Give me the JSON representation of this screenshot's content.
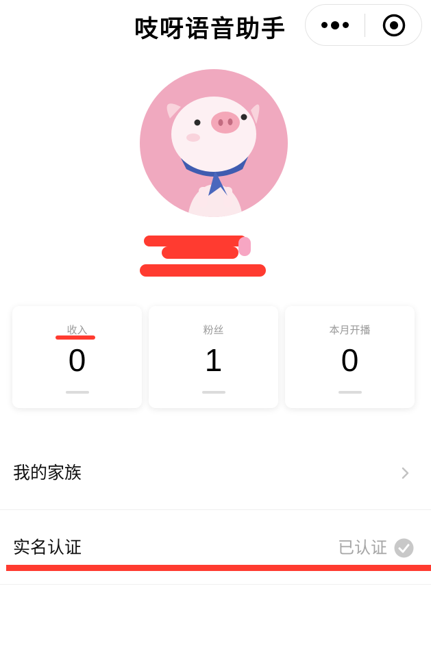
{
  "header": {
    "title": "吱呀语音助手",
    "more_button": "more-options",
    "close_button": "close-miniprogram"
  },
  "stats": [
    {
      "label": "收入",
      "value": "0"
    },
    {
      "label": "粉丝",
      "value": "1"
    },
    {
      "label": "本月开播",
      "value": "0"
    }
  ],
  "menu": [
    {
      "label": "我的家族",
      "icon": "chevron-right-icon"
    },
    {
      "label": "实名认证",
      "status": "已认证",
      "icon": "check-circle-icon"
    }
  ],
  "colors": {
    "redaction": "#ff3b30",
    "avatar_bg": "#f0a9bf",
    "muted_text": "#999999"
  }
}
